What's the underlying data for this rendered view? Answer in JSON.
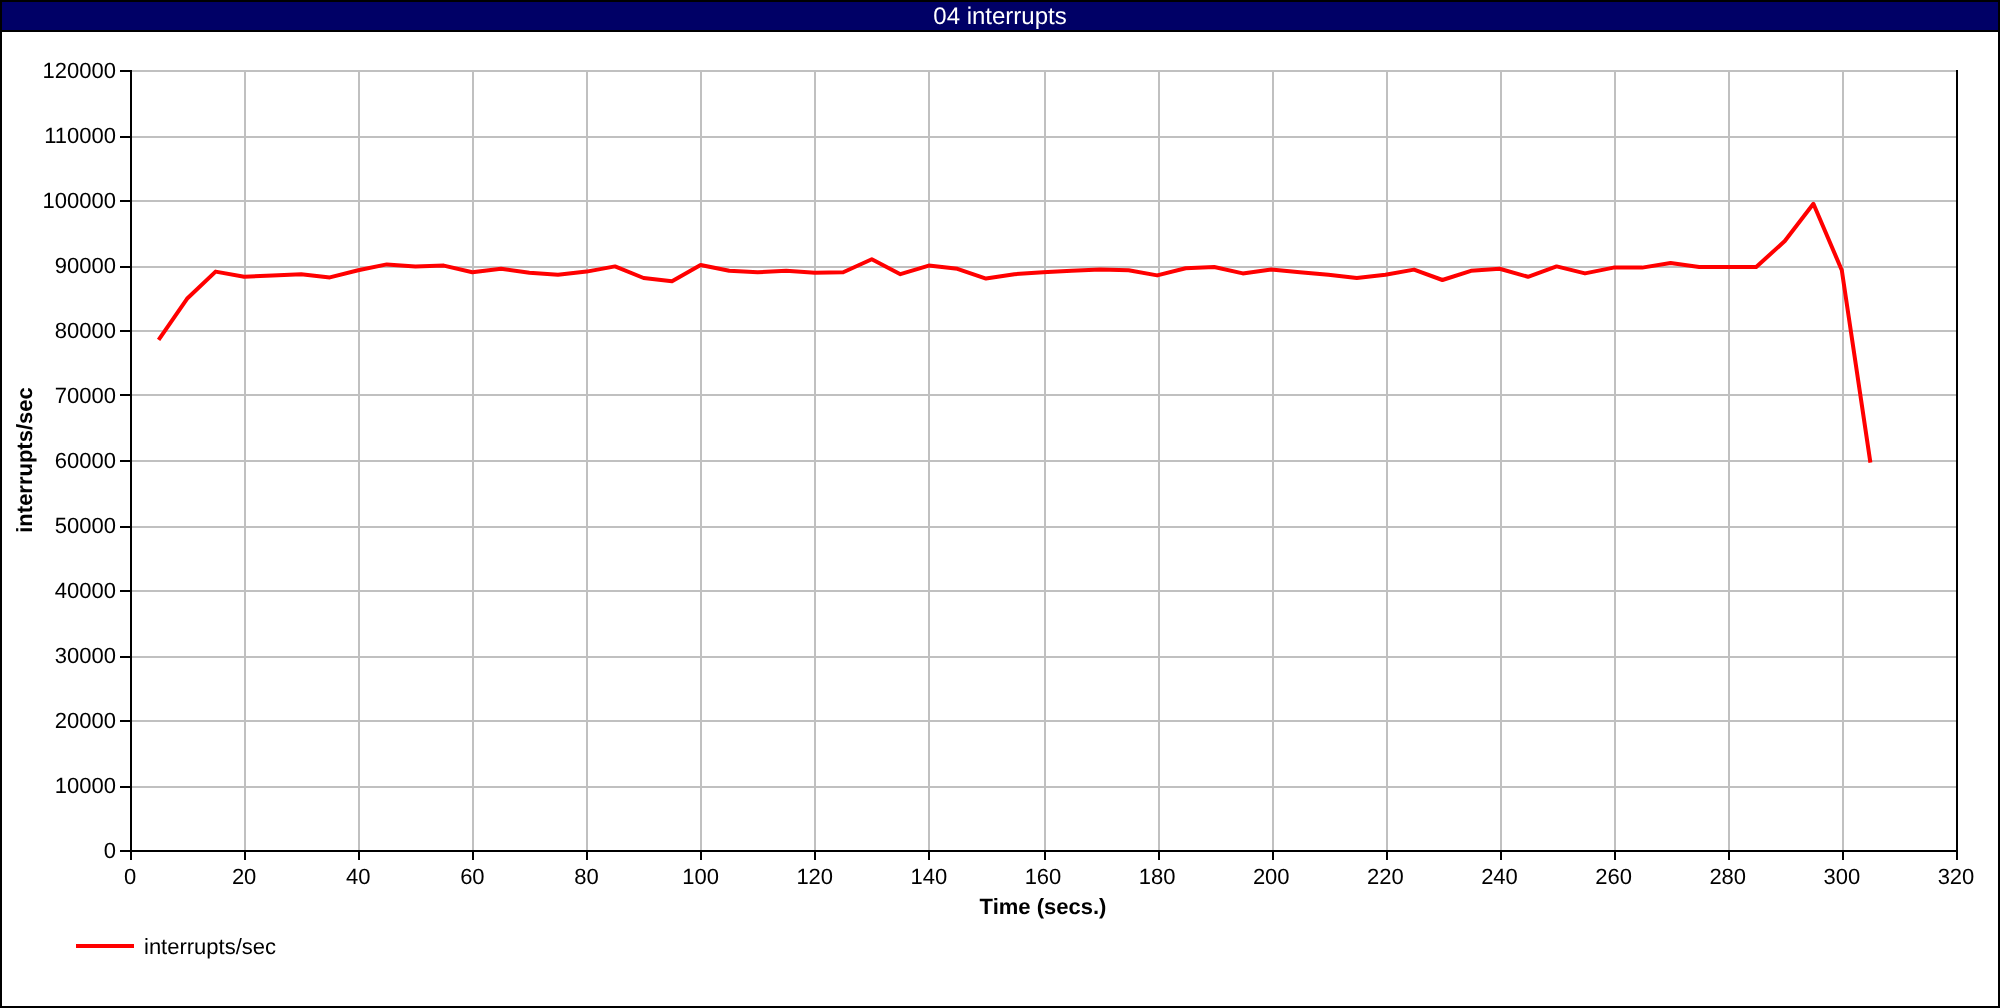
{
  "window": {
    "title": "04 interrupts"
  },
  "chart_data": {
    "type": "line",
    "xlabel": "Time (secs.)",
    "ylabel": "interrupts/sec",
    "x": [
      5,
      10,
      15,
      20,
      25,
      30,
      35,
      40,
      45,
      50,
      55,
      60,
      65,
      70,
      75,
      80,
      85,
      90,
      95,
      100,
      105,
      110,
      115,
      120,
      125,
      130,
      135,
      140,
      145,
      150,
      155,
      160,
      165,
      170,
      175,
      180,
      185,
      190,
      195,
      200,
      205,
      210,
      215,
      220,
      225,
      230,
      235,
      240,
      245,
      250,
      255,
      260,
      265,
      270,
      275,
      280,
      285,
      290,
      295,
      300,
      305
    ],
    "series": [
      {
        "name": "interrupts/sec",
        "color": "#ff0000",
        "values": [
          78500,
          84800,
          89000,
          88200,
          88400,
          88600,
          88100,
          89200,
          90100,
          89800,
          89900,
          88900,
          89400,
          88800,
          88500,
          89000,
          89800,
          88000,
          87500,
          90000,
          89100,
          88900,
          89100,
          88800,
          88900,
          90900,
          88600,
          89900,
          89400,
          87900,
          88600,
          88900,
          89100,
          89300,
          89200,
          88400,
          89500,
          89700,
          88700,
          89300,
          88900,
          88500,
          88000,
          88500,
          89300,
          87700,
          89100,
          89400,
          88200,
          89800,
          88700,
          89600,
          89600,
          90300,
          89700,
          89700,
          89700,
          93700,
          99400,
          89200,
          59600
        ]
      }
    ],
    "grid": true,
    "xlim": [
      0,
      320
    ],
    "ylim": [
      0,
      120000
    ],
    "xticks": [
      0,
      20,
      40,
      60,
      80,
      100,
      120,
      140,
      160,
      180,
      200,
      220,
      240,
      260,
      280,
      300,
      320
    ],
    "yticks": [
      0,
      10000,
      20000,
      30000,
      40000,
      50000,
      60000,
      70000,
      80000,
      90000,
      100000,
      110000,
      120000
    ]
  }
}
